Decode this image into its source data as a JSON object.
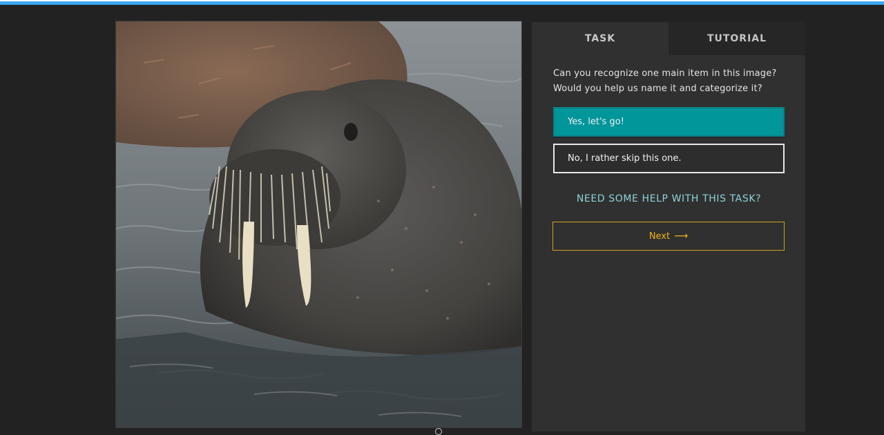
{
  "photo": {
    "subject": "walrus-photo"
  },
  "tabs": [
    {
      "label": "TASK",
      "active": true
    },
    {
      "label": "TUTORIAL",
      "active": false
    }
  ],
  "task": {
    "question_line1": "Can you recognize one main item in this image?",
    "question_line2": "Would you help us name it and categorize it?",
    "yes_label": "Yes, let's go!",
    "no_label": "No, I rather skip this one.",
    "help_label": "NEED SOME HELP WITH THIS TASK?",
    "next_label": "Next",
    "next_icon": "arrow-right-icon"
  },
  "colors": {
    "accent_top": "#3aa6ee",
    "yes_button": "#00969a",
    "help_link": "#8fd3d6",
    "next_border": "#d3a122",
    "next_text": "#f0b31b",
    "background": "#222222",
    "panel": "#303030"
  }
}
